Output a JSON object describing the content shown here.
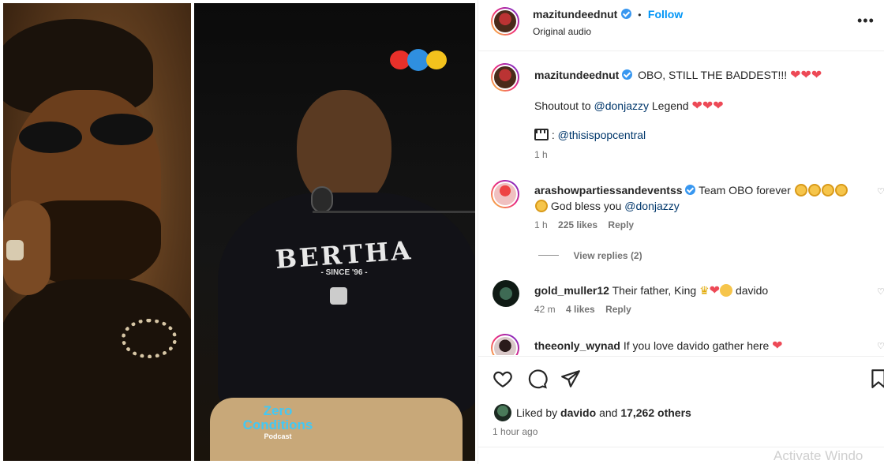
{
  "post": {
    "username": "mazitundeednut",
    "dot": "•",
    "follow_label": "Follow",
    "audio_label": "Original audio"
  },
  "caption": {
    "username": "mazitundeednut",
    "line1": "OBO, STILL THE BADDEST!!!",
    "line2_prefix": "Shoutout to",
    "line2_mention": "@donjazzy",
    "line2_suffix": "Legend",
    "credit_mention": "@thisispopcentral",
    "time": "1 h"
  },
  "comments": [
    {
      "username": "arashowpartiessandeventss",
      "text_before": "Team OBO forever",
      "text_line2": "God bless you",
      "mention": "@donjazzy",
      "time": "1 h",
      "likes": "225 likes",
      "reply_label": "Reply",
      "view_replies": "View replies (2)"
    },
    {
      "username": "gold_muller12",
      "text": "Their father, King",
      "text_after": "davido",
      "time": "42 m",
      "likes": "4 likes",
      "reply_label": "Reply"
    },
    {
      "username": "theeonly_wynad",
      "text": "If you love davido gather here"
    }
  ],
  "footer": {
    "liked_by_prefix": "Liked by",
    "liked_by_user": "davido",
    "liked_by_and": "and",
    "liked_by_count": "17,262 others",
    "time_ago": "1 hour ago"
  },
  "media": {
    "shirt_text": "BERTHA",
    "shirt_sub": "- SINCE '96 -",
    "podcast_title_1": "Zero",
    "podcast_title_2": "Conditions",
    "podcast_sub": "Podcast"
  },
  "watermark": "Activate Windo",
  "colors": {
    "accent": "#0095f6",
    "heart": "#ed4956",
    "verified": "#3897f0"
  }
}
